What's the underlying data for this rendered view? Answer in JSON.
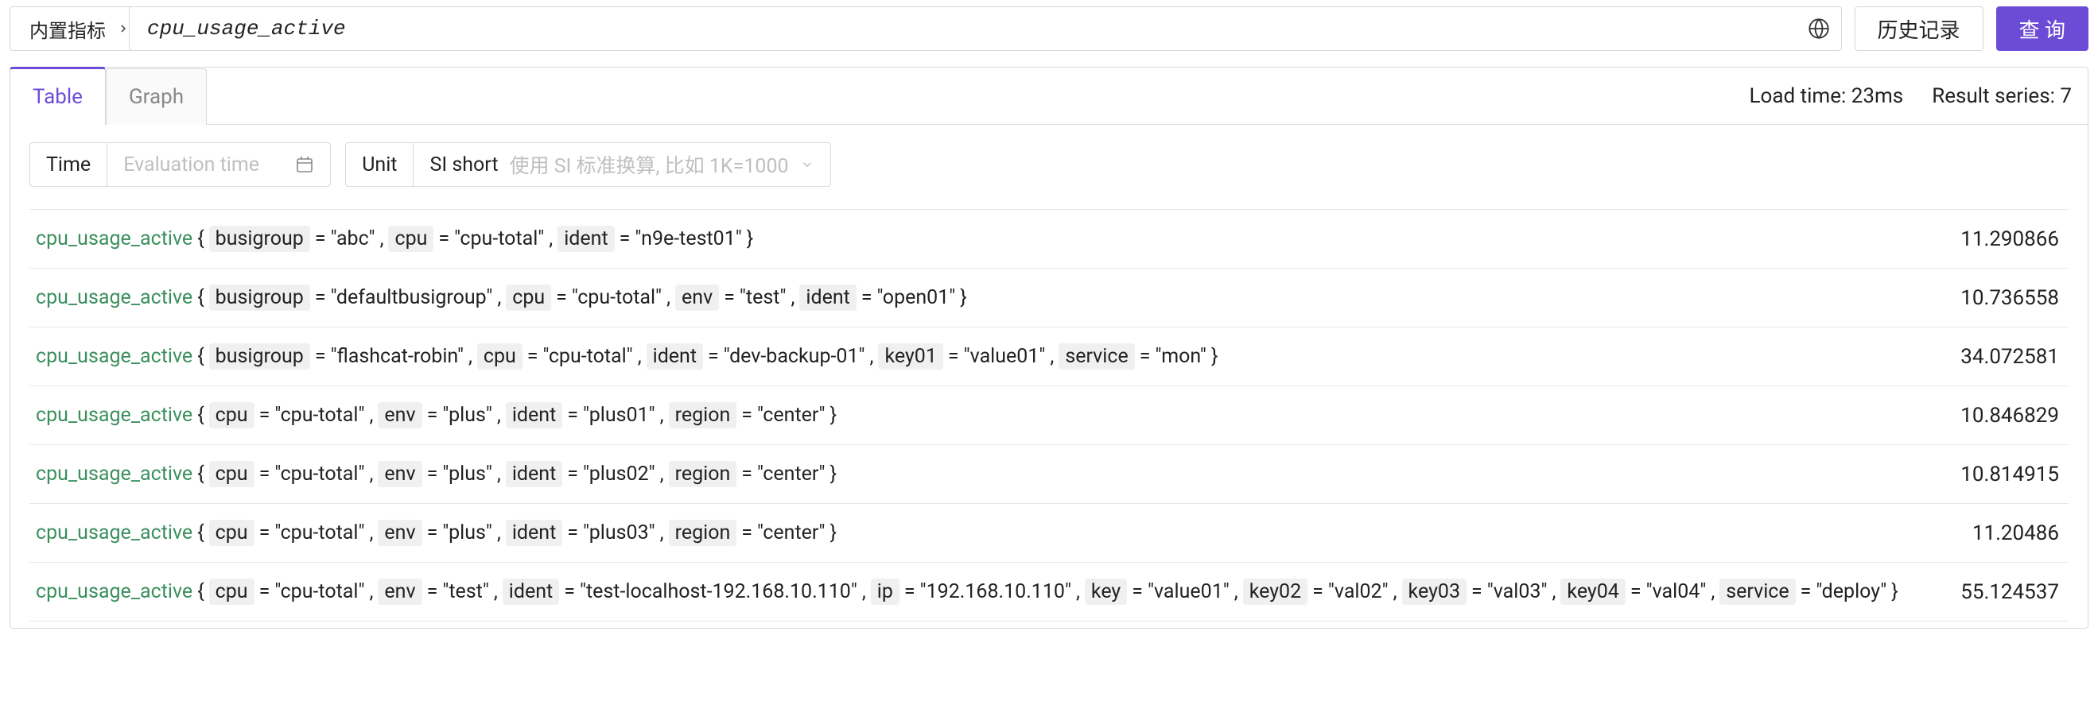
{
  "topbar": {
    "metric_selector_label": "内置指标",
    "query_value": "cpu_usage_active",
    "history_label": "历史记录",
    "query_button_label": "查 询"
  },
  "tabs": {
    "table": "Table",
    "graph": "Graph"
  },
  "stats": {
    "load_time_label": "Load time:",
    "load_time_value": "23ms",
    "result_series_label": "Result series:",
    "result_series_value": "7"
  },
  "controls": {
    "time_label": "Time",
    "time_placeholder": "Evaluation time",
    "unit_label": "Unit",
    "unit_value": "SI short",
    "unit_hint": "使用 SI 标准换算, 比如 1K=1000"
  },
  "metric_name": "cpu_usage_active",
  "rows": [
    {
      "tags": [
        [
          "busigroup",
          "abc"
        ],
        [
          "cpu",
          "cpu-total"
        ],
        [
          "ident",
          "n9e-test01"
        ]
      ],
      "value": "11.290866"
    },
    {
      "tags": [
        [
          "busigroup",
          "defaultbusigroup"
        ],
        [
          "cpu",
          "cpu-total"
        ],
        [
          "env",
          "test"
        ],
        [
          "ident",
          "open01"
        ]
      ],
      "value": "10.736558"
    },
    {
      "tags": [
        [
          "busigroup",
          "flashcat-robin"
        ],
        [
          "cpu",
          "cpu-total"
        ],
        [
          "ident",
          "dev-backup-01"
        ],
        [
          "key01",
          "value01"
        ],
        [
          "service",
          "mon"
        ]
      ],
      "value": "34.072581"
    },
    {
      "tags": [
        [
          "cpu",
          "cpu-total"
        ],
        [
          "env",
          "plus"
        ],
        [
          "ident",
          "plus01"
        ],
        [
          "region",
          "center"
        ]
      ],
      "value": "10.846829"
    },
    {
      "tags": [
        [
          "cpu",
          "cpu-total"
        ],
        [
          "env",
          "plus"
        ],
        [
          "ident",
          "plus02"
        ],
        [
          "region",
          "center"
        ]
      ],
      "value": "10.814915"
    },
    {
      "tags": [
        [
          "cpu",
          "cpu-total"
        ],
        [
          "env",
          "plus"
        ],
        [
          "ident",
          "plus03"
        ],
        [
          "region",
          "center"
        ]
      ],
      "value": "11.20486"
    },
    {
      "tags": [
        [
          "cpu",
          "cpu-total"
        ],
        [
          "env",
          "test"
        ],
        [
          "ident",
          "test-localhost-192.168.10.110"
        ],
        [
          "ip",
          "192.168.10.110"
        ],
        [
          "key",
          "value01"
        ],
        [
          "key02",
          "val02"
        ],
        [
          "key03",
          "val03"
        ],
        [
          "key04",
          "val04"
        ],
        [
          "service",
          "deploy"
        ]
      ],
      "value": "55.124537"
    }
  ]
}
